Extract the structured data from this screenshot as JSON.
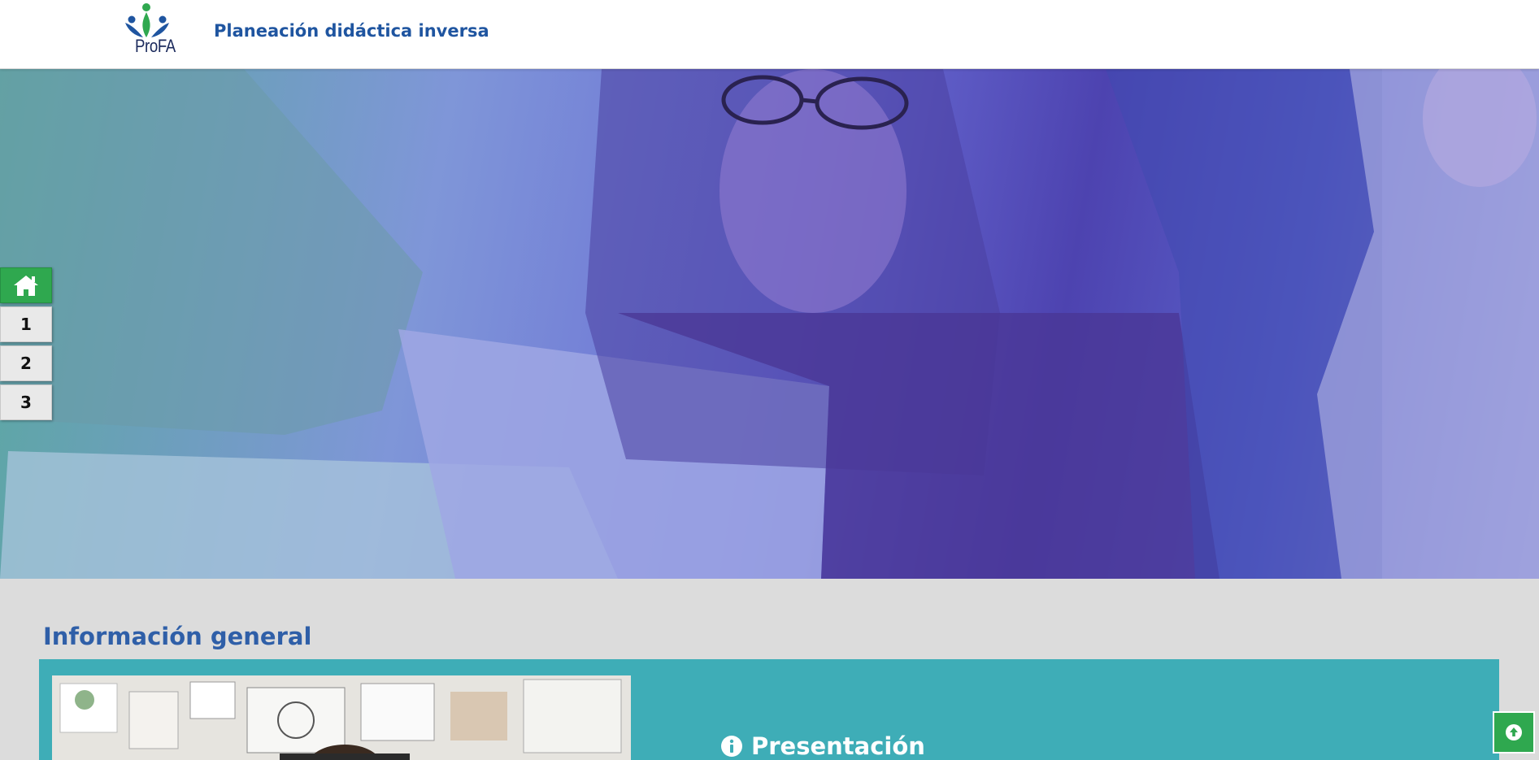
{
  "header": {
    "logo_text": "ProFA",
    "site_title": "Planeación didáctica inversa"
  },
  "sidebar": {
    "items": [
      {
        "label": "",
        "icon": "home-icon"
      },
      {
        "label": "1"
      },
      {
        "label": "2"
      },
      {
        "label": "3"
      }
    ]
  },
  "main": {
    "section_title": "Información general",
    "panel": {
      "heading": "Presentación",
      "heading_icon": "info-circle-icon"
    }
  },
  "scroll_top": {
    "icon": "arrow-up-circle-icon"
  },
  "colors": {
    "brand_blue": "#1f55a0",
    "accent_green": "#2fa84f",
    "panel_teal": "#3eadb7",
    "section_title": "#2f5fa8"
  }
}
